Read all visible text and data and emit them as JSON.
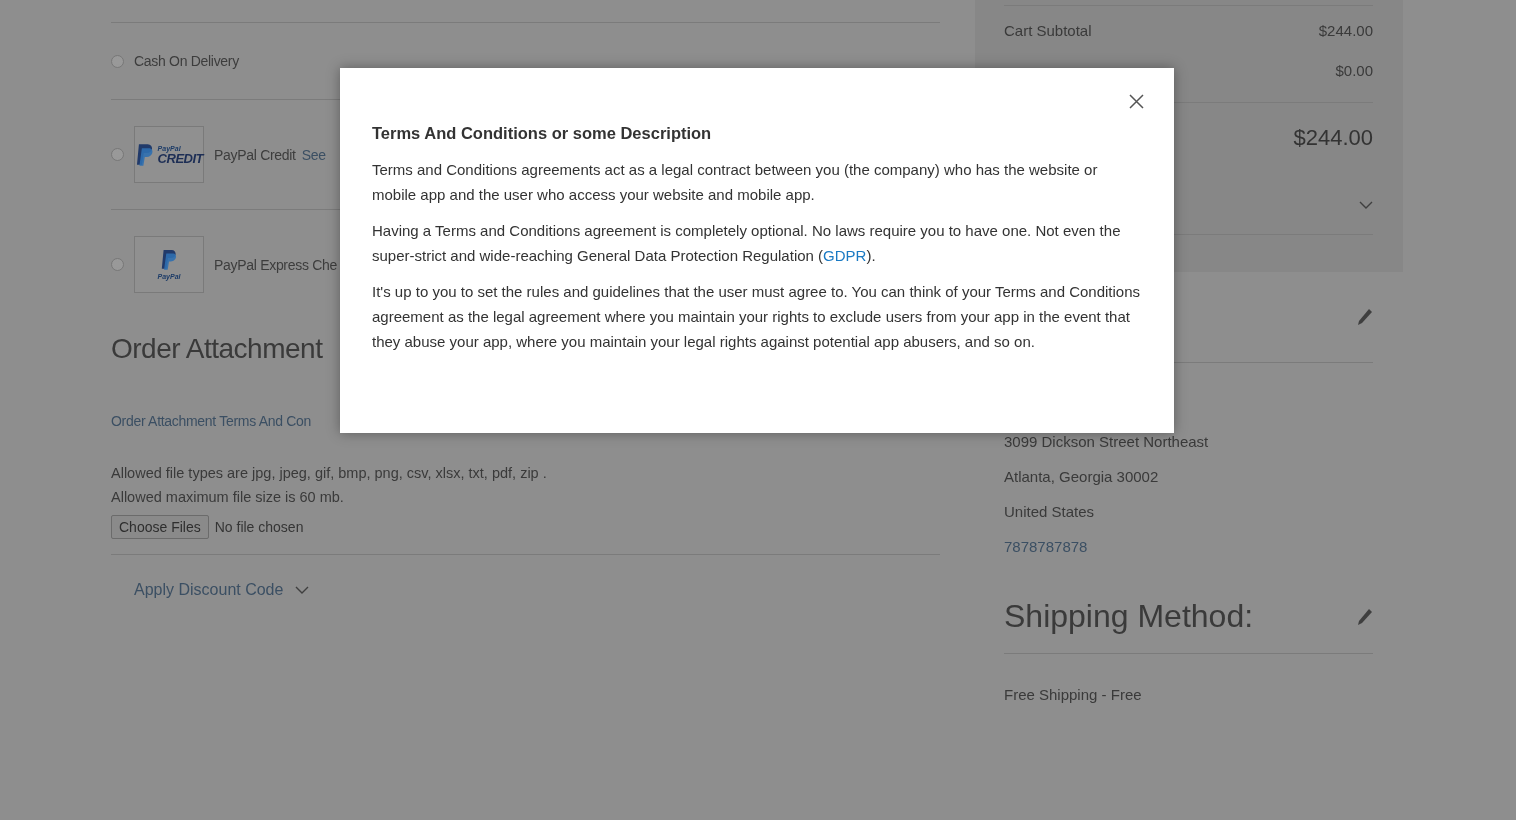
{
  "payment_methods": [
    {
      "kind": "plain",
      "label": "Cash On Delivery",
      "selected": false
    },
    {
      "kind": "credit",
      "label": "PayPal Credit",
      "link": "See",
      "logo_text": [
        "PayPal",
        "CREDIT"
      ],
      "selected": false
    },
    {
      "kind": "express",
      "label": "PayPal Express Che",
      "logo_text": [
        "PayPal"
      ],
      "selected": false
    }
  ],
  "order_attachment": {
    "title": "Order Attachment",
    "terms_link": "Order Attachment Terms And Con",
    "notes": [
      "Allowed file types are jpg, jpeg, gif, bmp, png, csv, xlsx, txt, pdf, zip .",
      "Allowed maximum file size is 60 mb."
    ],
    "file_button": "Choose Files",
    "file_status": "No file chosen"
  },
  "discount": {
    "label": "Apply Discount Code",
    "expanded": false
  },
  "summary": {
    "rows": [
      {
        "label": "Cart Subtotal",
        "value": "$244.00"
      },
      {
        "value": "$0.00"
      }
    ],
    "total": "$244.00",
    "expanded": false
  },
  "ship_to": {
    "lines": [
      "3099 Dickson Street Northeast",
      "Atlanta, Georgia 30002",
      "United States"
    ],
    "phone": "7878787878"
  },
  "shipping_method": {
    "title": "Shipping Method:",
    "value": "Free Shipping - Free"
  },
  "modal": {
    "title": "Terms And Conditions or some Description",
    "paragraphs": [
      [
        {
          "text": "Terms and Conditions agreements act as a legal contract between you (the company) who has the website or mobile app and the user who access your website and mobile app."
        }
      ],
      [
        {
          "text": "Having a Terms and Conditions agreement is completely optional. No laws require you to have one. Not even the super-strict and wide-reaching General Data Protection Regulation ("
        },
        {
          "link": "GDPR"
        },
        {
          "text": ")."
        }
      ],
      [
        {
          "text": "It's up to you to set the rules and guidelines that the user must agree to. You can think of your Terms and Conditions agreement as the legal agreement where you maintain your rights to exclude users from your app in the event that they abuse your app, where you maintain your legal rights against potential app abusers, and so on."
        }
      ]
    ]
  }
}
